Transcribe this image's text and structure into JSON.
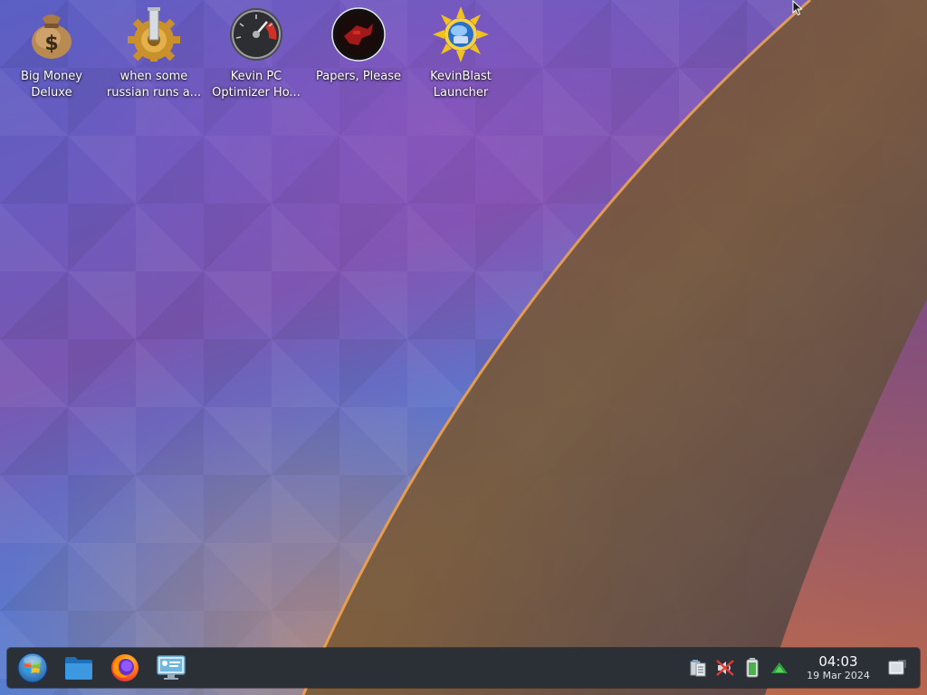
{
  "desktop": {
    "icons": [
      {
        "label": "Big Money\nDeluxe",
        "icon": "money-bag-icon"
      },
      {
        "label": "when some\nrussian runs a...",
        "icon": "gear-piston-icon"
      },
      {
        "label": "Kevin PC\nOptimizer Ho...",
        "icon": "speedometer-icon"
      },
      {
        "label": "Papers, Please",
        "icon": "papers-please-icon"
      },
      {
        "label": "KevinBlast\nLauncher",
        "icon": "sun-disc-icon"
      }
    ]
  },
  "taskbar": {
    "launchers": [
      {
        "name": "start-menu-button",
        "icon": "windows-orb-icon"
      },
      {
        "name": "file-manager-launcher",
        "icon": "folder-icon"
      },
      {
        "name": "firefox-launcher",
        "icon": "firefox-icon"
      },
      {
        "name": "system-settings-launcher",
        "icon": "settings-monitor-icon"
      }
    ],
    "tray": [
      {
        "name": "clipboard-tray",
        "icon": "clipboard-icon"
      },
      {
        "name": "audio-muted-tray",
        "icon": "speaker-muted-icon"
      },
      {
        "name": "battery-tray",
        "icon": "battery-icon"
      },
      {
        "name": "network-tray",
        "icon": "network-triangle-icon"
      }
    ],
    "clock": {
      "time": "04:03",
      "date": "19 Mar 2024"
    }
  }
}
